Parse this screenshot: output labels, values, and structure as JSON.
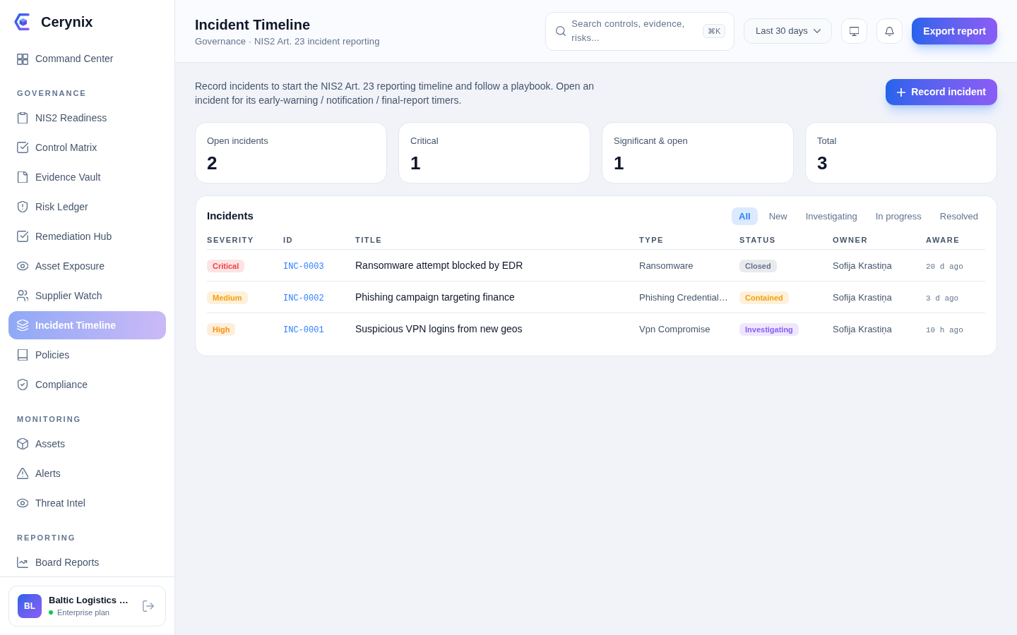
{
  "brand": {
    "name": "Cerynix"
  },
  "sidebar": {
    "top_items": [
      {
        "label": "Command Center",
        "selected": false
      }
    ],
    "sections": [
      {
        "title": "GOVERNANCE",
        "items": [
          {
            "label": "NIS2 Readiness",
            "selected": false
          },
          {
            "label": "Control Matrix",
            "selected": false
          },
          {
            "label": "Evidence Vault",
            "selected": false
          },
          {
            "label": "Risk Ledger",
            "selected": false
          },
          {
            "label": "Remediation Hub",
            "selected": false
          },
          {
            "label": "Asset Exposure",
            "selected": false
          },
          {
            "label": "Supplier Watch",
            "selected": false
          },
          {
            "label": "Incident Timeline",
            "selected": true
          },
          {
            "label": "Policies",
            "selected": false
          },
          {
            "label": "Compliance",
            "selected": false
          }
        ]
      },
      {
        "title": "MONITORING",
        "items": [
          {
            "label": "Assets",
            "selected": false
          },
          {
            "label": "Alerts",
            "selected": false
          },
          {
            "label": "Threat Intel",
            "selected": false
          }
        ]
      },
      {
        "title": "REPORTING",
        "items": [
          {
            "label": "Board Reports",
            "selected": false
          }
        ]
      }
    ],
    "organization": {
      "initials": "BL",
      "name": "Baltic Logistics …",
      "plan": "Enterprise plan"
    }
  },
  "header": {
    "title": "Incident Timeline",
    "subtitle": "Governance · NIS2 Art. 23 incident reporting",
    "search": {
      "placeholder": "Search controls, evidence, risks...",
      "shortcut": "⌘K"
    },
    "date_range": "Last 30 days",
    "export_button": "Export report"
  },
  "intro": {
    "text": "Record incidents to start the NIS2 Art. 23 reporting timeline and follow a playbook. Open an incident for its early-warning / notification / final-report timers.",
    "record_button": "Record incident"
  },
  "stats": [
    {
      "label": "Open incidents",
      "value": "2"
    },
    {
      "label": "Critical",
      "value": "1"
    },
    {
      "label": "Significant & open",
      "value": "1"
    },
    {
      "label": "Total",
      "value": "3"
    }
  ],
  "incidents": {
    "title": "Incidents",
    "filters": [
      {
        "label": "All",
        "selected": true
      },
      {
        "label": "New",
        "selected": false
      },
      {
        "label": "Investigating",
        "selected": false
      },
      {
        "label": "In progress",
        "selected": false
      },
      {
        "label": "Resolved",
        "selected": false
      }
    ],
    "table": {
      "columns": [
        "SEVERITY",
        "ID",
        "TITLE",
        "TYPE",
        "STATUS",
        "OWNER",
        "AWARE"
      ],
      "rows": [
        {
          "severity": {
            "label": "Critical",
            "color": "#ef4444"
          },
          "id": "INC-0003",
          "title": "Ransomware attempt blocked by EDR",
          "type": "Ransomware",
          "status": {
            "label": "Closed",
            "color": "#64748b"
          },
          "owner": "Sofija Krastiņa",
          "aware": "20 d ago"
        },
        {
          "severity": {
            "label": "Medium",
            "color": "#f59e0b"
          },
          "id": "INC-0002",
          "title": "Phishing campaign targeting finance",
          "type": "Phishing Credential…",
          "status": {
            "label": "Contained",
            "color": "#f59e0b"
          },
          "owner": "Sofija Krastiņa",
          "aware": "3 d ago"
        },
        {
          "severity": {
            "label": "High",
            "color": "#f7920e"
          },
          "id": "INC-0001",
          "title": "Suspicious VPN logins from new geos",
          "type": "Vpn Compromise",
          "status": {
            "label": "Investigating",
            "color": "#8b5cf6"
          },
          "owner": "Sofija Krastiņa",
          "aware": "10 h ago"
        }
      ]
    }
  }
}
